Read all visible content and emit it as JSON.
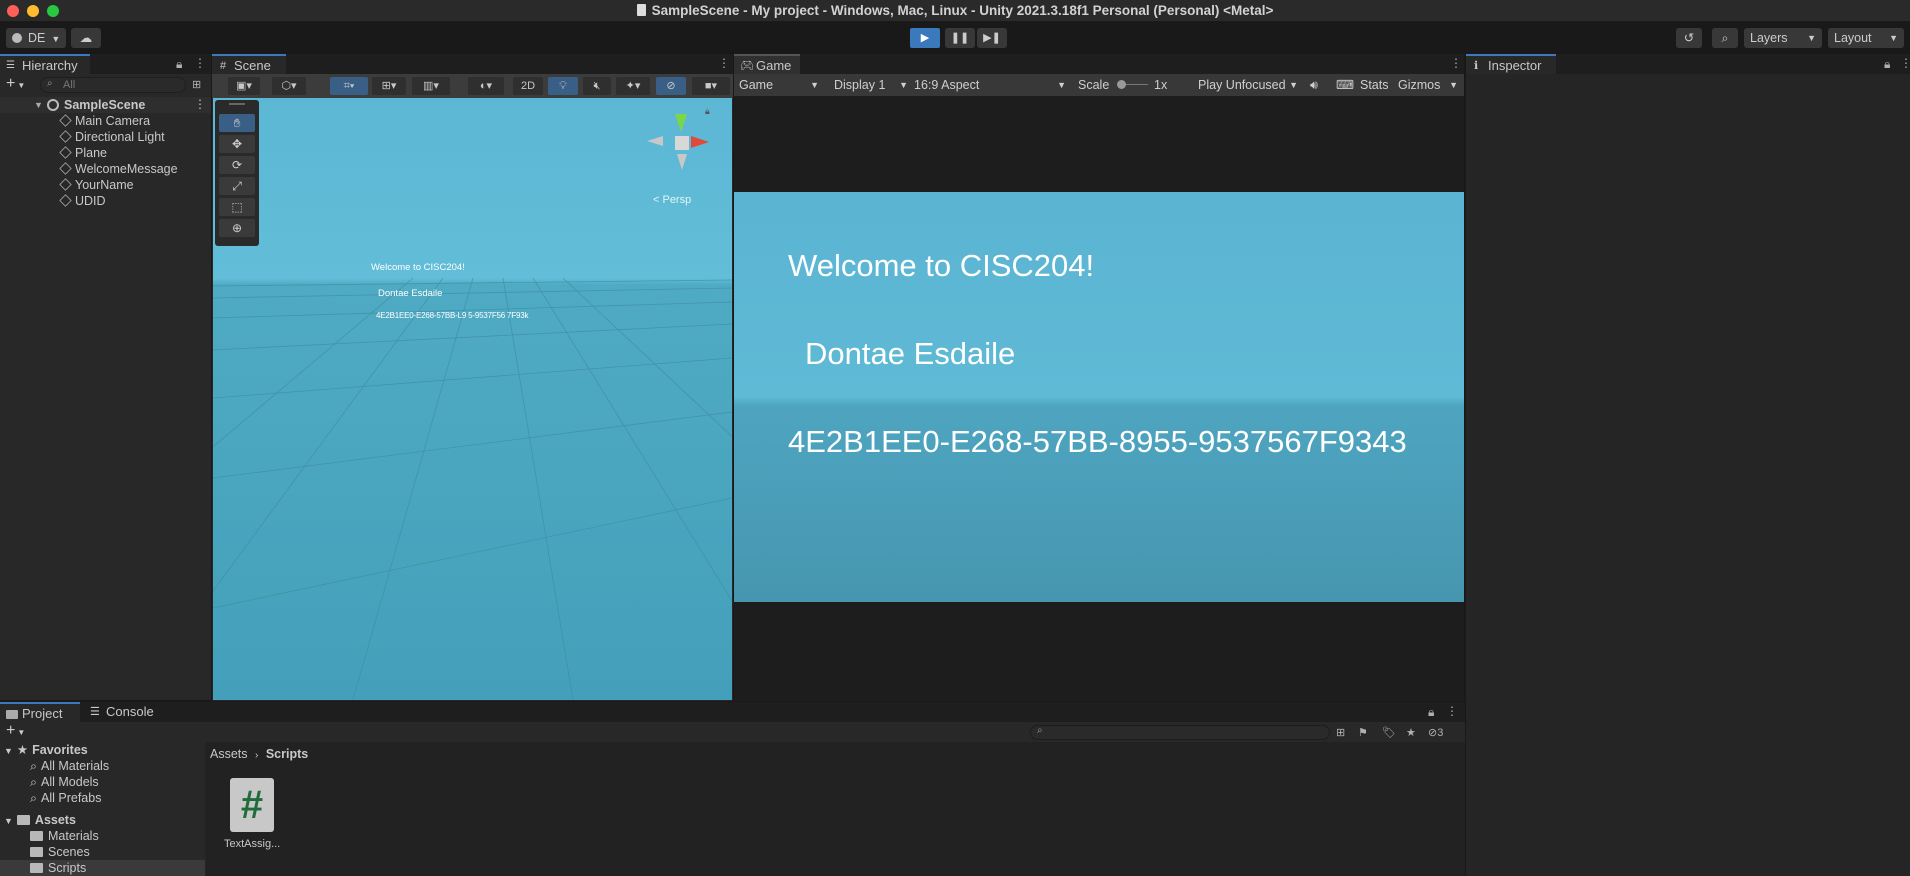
{
  "window": {
    "title": "SampleScene - My project - Windows, Mac, Linux - Unity 2021.3.18f1 Personal (Personal) <Metal>",
    "colors": {
      "close": "#fe5f57",
      "minimize": "#febc2e",
      "zoom": "#28c840",
      "accent": "#3a79bb"
    }
  },
  "toolbar": {
    "account_label": "DE",
    "layers_label": "Layers",
    "layout_label": "Layout",
    "play_icon": "play-icon",
    "pause_icon": "pause-icon",
    "step_icon": "step-icon"
  },
  "hierarchy": {
    "tab_label": "Hierarchy",
    "search_placeholder": "All",
    "scene_name": "SampleScene",
    "items": [
      "Main Camera",
      "Directional Light",
      "Plane",
      "WelcomeMessage",
      "YourName",
      "UDID"
    ]
  },
  "scene": {
    "tab_label": "Scene",
    "mode_2d_label": "2D",
    "persp_label": "< Persp",
    "text_welcome": "Welcome to CISC204!",
    "text_name": "Dontae Esdaile",
    "text_udid": "4E2B1EE0-E268-57BB-L9  5-9537F56 7F93k"
  },
  "game": {
    "tab_label": "Game",
    "view_select": "Game",
    "display_select": "Display 1",
    "aspect_select": "16:9 Aspect",
    "scale_label": "Scale",
    "scale_value": "1x",
    "play_mode_select": "Play Unfocused",
    "stats_label": "Stats",
    "gizmos_label": "Gizmos",
    "text_welcome": "Welcome to CISC204!",
    "text_name": "Dontae Esdaile",
    "text_udid": "4E2B1EE0-E268-57BB-8955-9537567F9343"
  },
  "inspector": {
    "tab_label": "Inspector"
  },
  "project": {
    "tab_label": "Project",
    "console_tab_label": "Console",
    "hidden_count": "3",
    "favorites_label": "Favorites",
    "favorites": [
      "All Materials",
      "All Models",
      "All Prefabs"
    ],
    "assets_label": "Assets",
    "assets_folders": [
      "Materials",
      "Scenes",
      "Scripts"
    ],
    "breadcrumb_root": "Assets",
    "breadcrumb_current": "Scripts",
    "files": [
      {
        "name": "TextAssig...",
        "icon": "csharp-script-icon"
      }
    ]
  }
}
